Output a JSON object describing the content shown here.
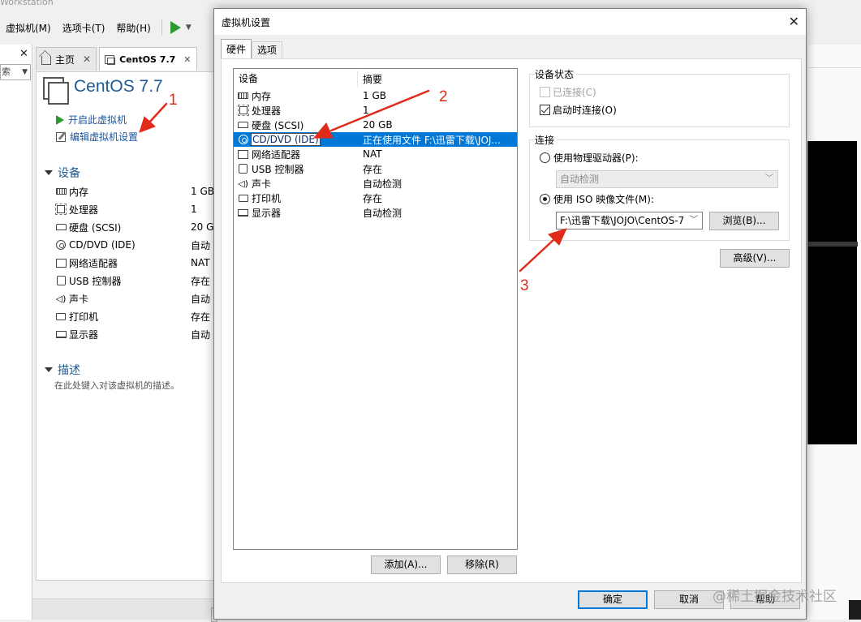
{
  "app": {
    "title_fragment": "Workstation",
    "menu": [
      "虚拟机(M)",
      "选项卡(T)",
      "帮助(H)"
    ],
    "library_search_fragment": "索",
    "tabs": [
      {
        "label": "主页"
      },
      {
        "label": "CentOS 7.7"
      }
    ],
    "vm": {
      "name": "CentOS 7.7",
      "actions": [
        "开启此虚拟机",
        "编辑虚拟机设置"
      ],
      "devices_heading": "设备",
      "devices": [
        {
          "name": "内存",
          "value": "1 GB",
          "icon": "memory-icon"
        },
        {
          "name": "处理器",
          "value": "1",
          "icon": "cpu-icon"
        },
        {
          "name": "硬盘 (SCSI)",
          "value": "20 G",
          "icon": "hdd-icon"
        },
        {
          "name": "CD/DVD (IDE)",
          "value": "自动",
          "icon": "cd-icon"
        },
        {
          "name": "网络适配器",
          "value": "NAT",
          "icon": "network-icon"
        },
        {
          "name": "USB 控制器",
          "value": "存在",
          "icon": "usb-icon"
        },
        {
          "name": "声卡",
          "value": "自动",
          "icon": "sound-icon"
        },
        {
          "name": "打印机",
          "value": "存在",
          "icon": "printer-icon"
        },
        {
          "name": "显示器",
          "value": "自动",
          "icon": "monitor-icon"
        }
      ],
      "description_heading": "描述",
      "description_hint": "在此处键入对该虚拟机的描述。"
    },
    "bottom_buttons": [
      "添加(A)",
      "移除(R)"
    ]
  },
  "dialog": {
    "title": "虚拟机设置",
    "tabs": [
      "硬件",
      "选项"
    ],
    "hardware": {
      "col_device": "设备",
      "col_summary": "摘要",
      "rows": [
        {
          "device": "内存",
          "summary": "1 GB",
          "icon": "memory-icon"
        },
        {
          "device": "处理器",
          "summary": "1",
          "icon": "cpu-icon"
        },
        {
          "device": "硬盘 (SCSI)",
          "summary": "20 GB",
          "icon": "hdd-icon"
        },
        {
          "device": "CD/DVD (IDE)",
          "summary": "正在使用文件 F:\\迅雷下载\\JOJ...",
          "icon": "cd-icon",
          "selected": true
        },
        {
          "device": "网络适配器",
          "summary": "NAT",
          "icon": "network-icon"
        },
        {
          "device": "USB 控制器",
          "summary": "存在",
          "icon": "usb-icon"
        },
        {
          "device": "声卡",
          "summary": "自动检测",
          "icon": "sound-icon"
        },
        {
          "device": "打印机",
          "summary": "存在",
          "icon": "printer-icon"
        },
        {
          "device": "显示器",
          "summary": "自动检测",
          "icon": "monitor-icon"
        }
      ],
      "add_button": "添加(A)...",
      "remove_button": "移除(R)"
    },
    "device_status": {
      "heading": "设备状态",
      "connected_label": "已连接(C)",
      "connected_checked": false,
      "connected_enabled": false,
      "connect_on_power_label": "启动时连接(O)",
      "connect_on_power_checked": true
    },
    "connection": {
      "heading": "连接",
      "physical_label": "使用物理驱动器(P):",
      "physical_selected": false,
      "physical_value": "自动检测",
      "iso_label": "使用 ISO 映像文件(M):",
      "iso_selected": true,
      "iso_path": "F:\\迅雷下载\\JOJO\\CentOS-7",
      "browse_button": "浏览(B)..."
    },
    "advanced_button": "高级(V)...",
    "footer": {
      "ok": "确定",
      "cancel": "取消",
      "help": "帮助"
    }
  },
  "annotations": [
    "1",
    "2",
    "3"
  ],
  "watermark": "@稀土掘金技术社区",
  "colors": {
    "annotation_red": "#e02a1a",
    "selection_blue": "#0078d7",
    "vm_title_blue": "#1e5a96",
    "play_green": "#2e9a2e"
  }
}
